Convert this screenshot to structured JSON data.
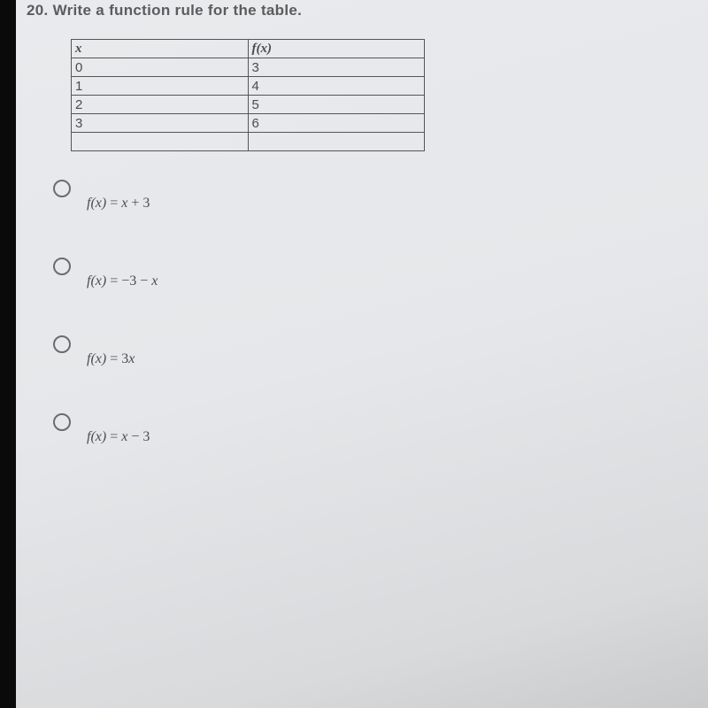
{
  "question": {
    "number": "20.",
    "text": "Write a function rule for the table."
  },
  "chart_data": {
    "type": "table",
    "columns": [
      "x",
      "f(x)"
    ],
    "rows": [
      {
        "x": "0",
        "fx": "3"
      },
      {
        "x": "1",
        "fx": "4"
      },
      {
        "x": "2",
        "fx": "5"
      },
      {
        "x": "3",
        "fx": "6"
      },
      {
        "x": "",
        "fx": ""
      }
    ]
  },
  "options": [
    {
      "fn": "f(x)",
      "eq": " = ",
      "expr_var": "x",
      "expr_rest": " + 3"
    },
    {
      "fn": "f(x)",
      "eq": " = ",
      "expr_pre": "−3 − ",
      "expr_var": "x",
      "expr_rest": ""
    },
    {
      "fn": "f(x)",
      "eq": " = ",
      "expr_pre": "3",
      "expr_var": "x",
      "expr_rest": ""
    },
    {
      "fn": "f(x)",
      "eq": " = ",
      "expr_var": "x",
      "expr_rest": " − 3"
    }
  ]
}
